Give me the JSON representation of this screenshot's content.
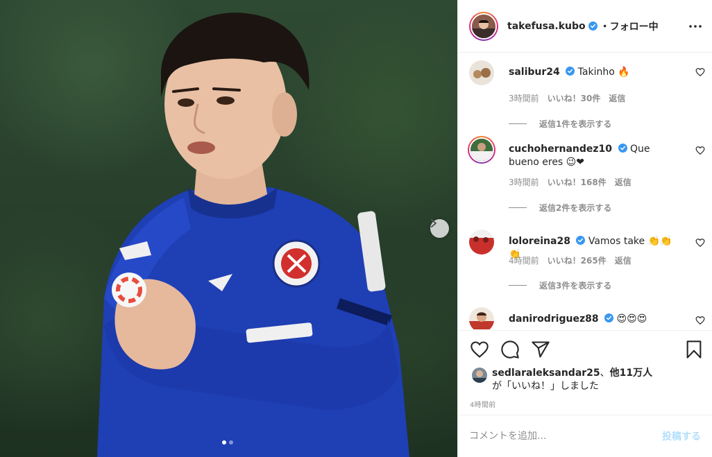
{
  "post": {
    "author": "takefusa.kubo",
    "follow_status": "・フォロー中",
    "carousel_dots": 2
  },
  "comments": [
    {
      "user": "salibur24",
      "text": "Takinho 🔥",
      "time": "3時間前",
      "likes": "いいね！30件",
      "reply": "返信",
      "view_replies": "返信1件を表示する",
      "story_ring": false
    },
    {
      "user": "cuchohernandez10",
      "text": "Que bueno eres 😉❤",
      "time": "3時間前",
      "likes": "いいね！168件",
      "reply": "返信",
      "view_replies": "返信2件を表示する",
      "story_ring": true
    },
    {
      "user": "loloreina28",
      "text": "Vamos take 👏👏👏",
      "time": "4時間前",
      "likes": "いいね！265件",
      "reply": "返信",
      "view_replies": "返信3件を表示する",
      "story_ring": false
    },
    {
      "user": "danirodriguez88",
      "text": "😍😍😍",
      "story_ring": false
    }
  ],
  "liked_by": {
    "users": "sedlaraleksandar25",
    "separator": "、",
    "others": "他11万人",
    "suffix": "が「いいね！」しました"
  },
  "timestamp": "4時間前",
  "composer": {
    "placeholder": "コメントを追加...",
    "post_label": "投稿する"
  },
  "colors": {
    "jersey": "#1e3fb8",
    "verified": "#3897f0",
    "post_button_disabled": "#b2dffc"
  }
}
